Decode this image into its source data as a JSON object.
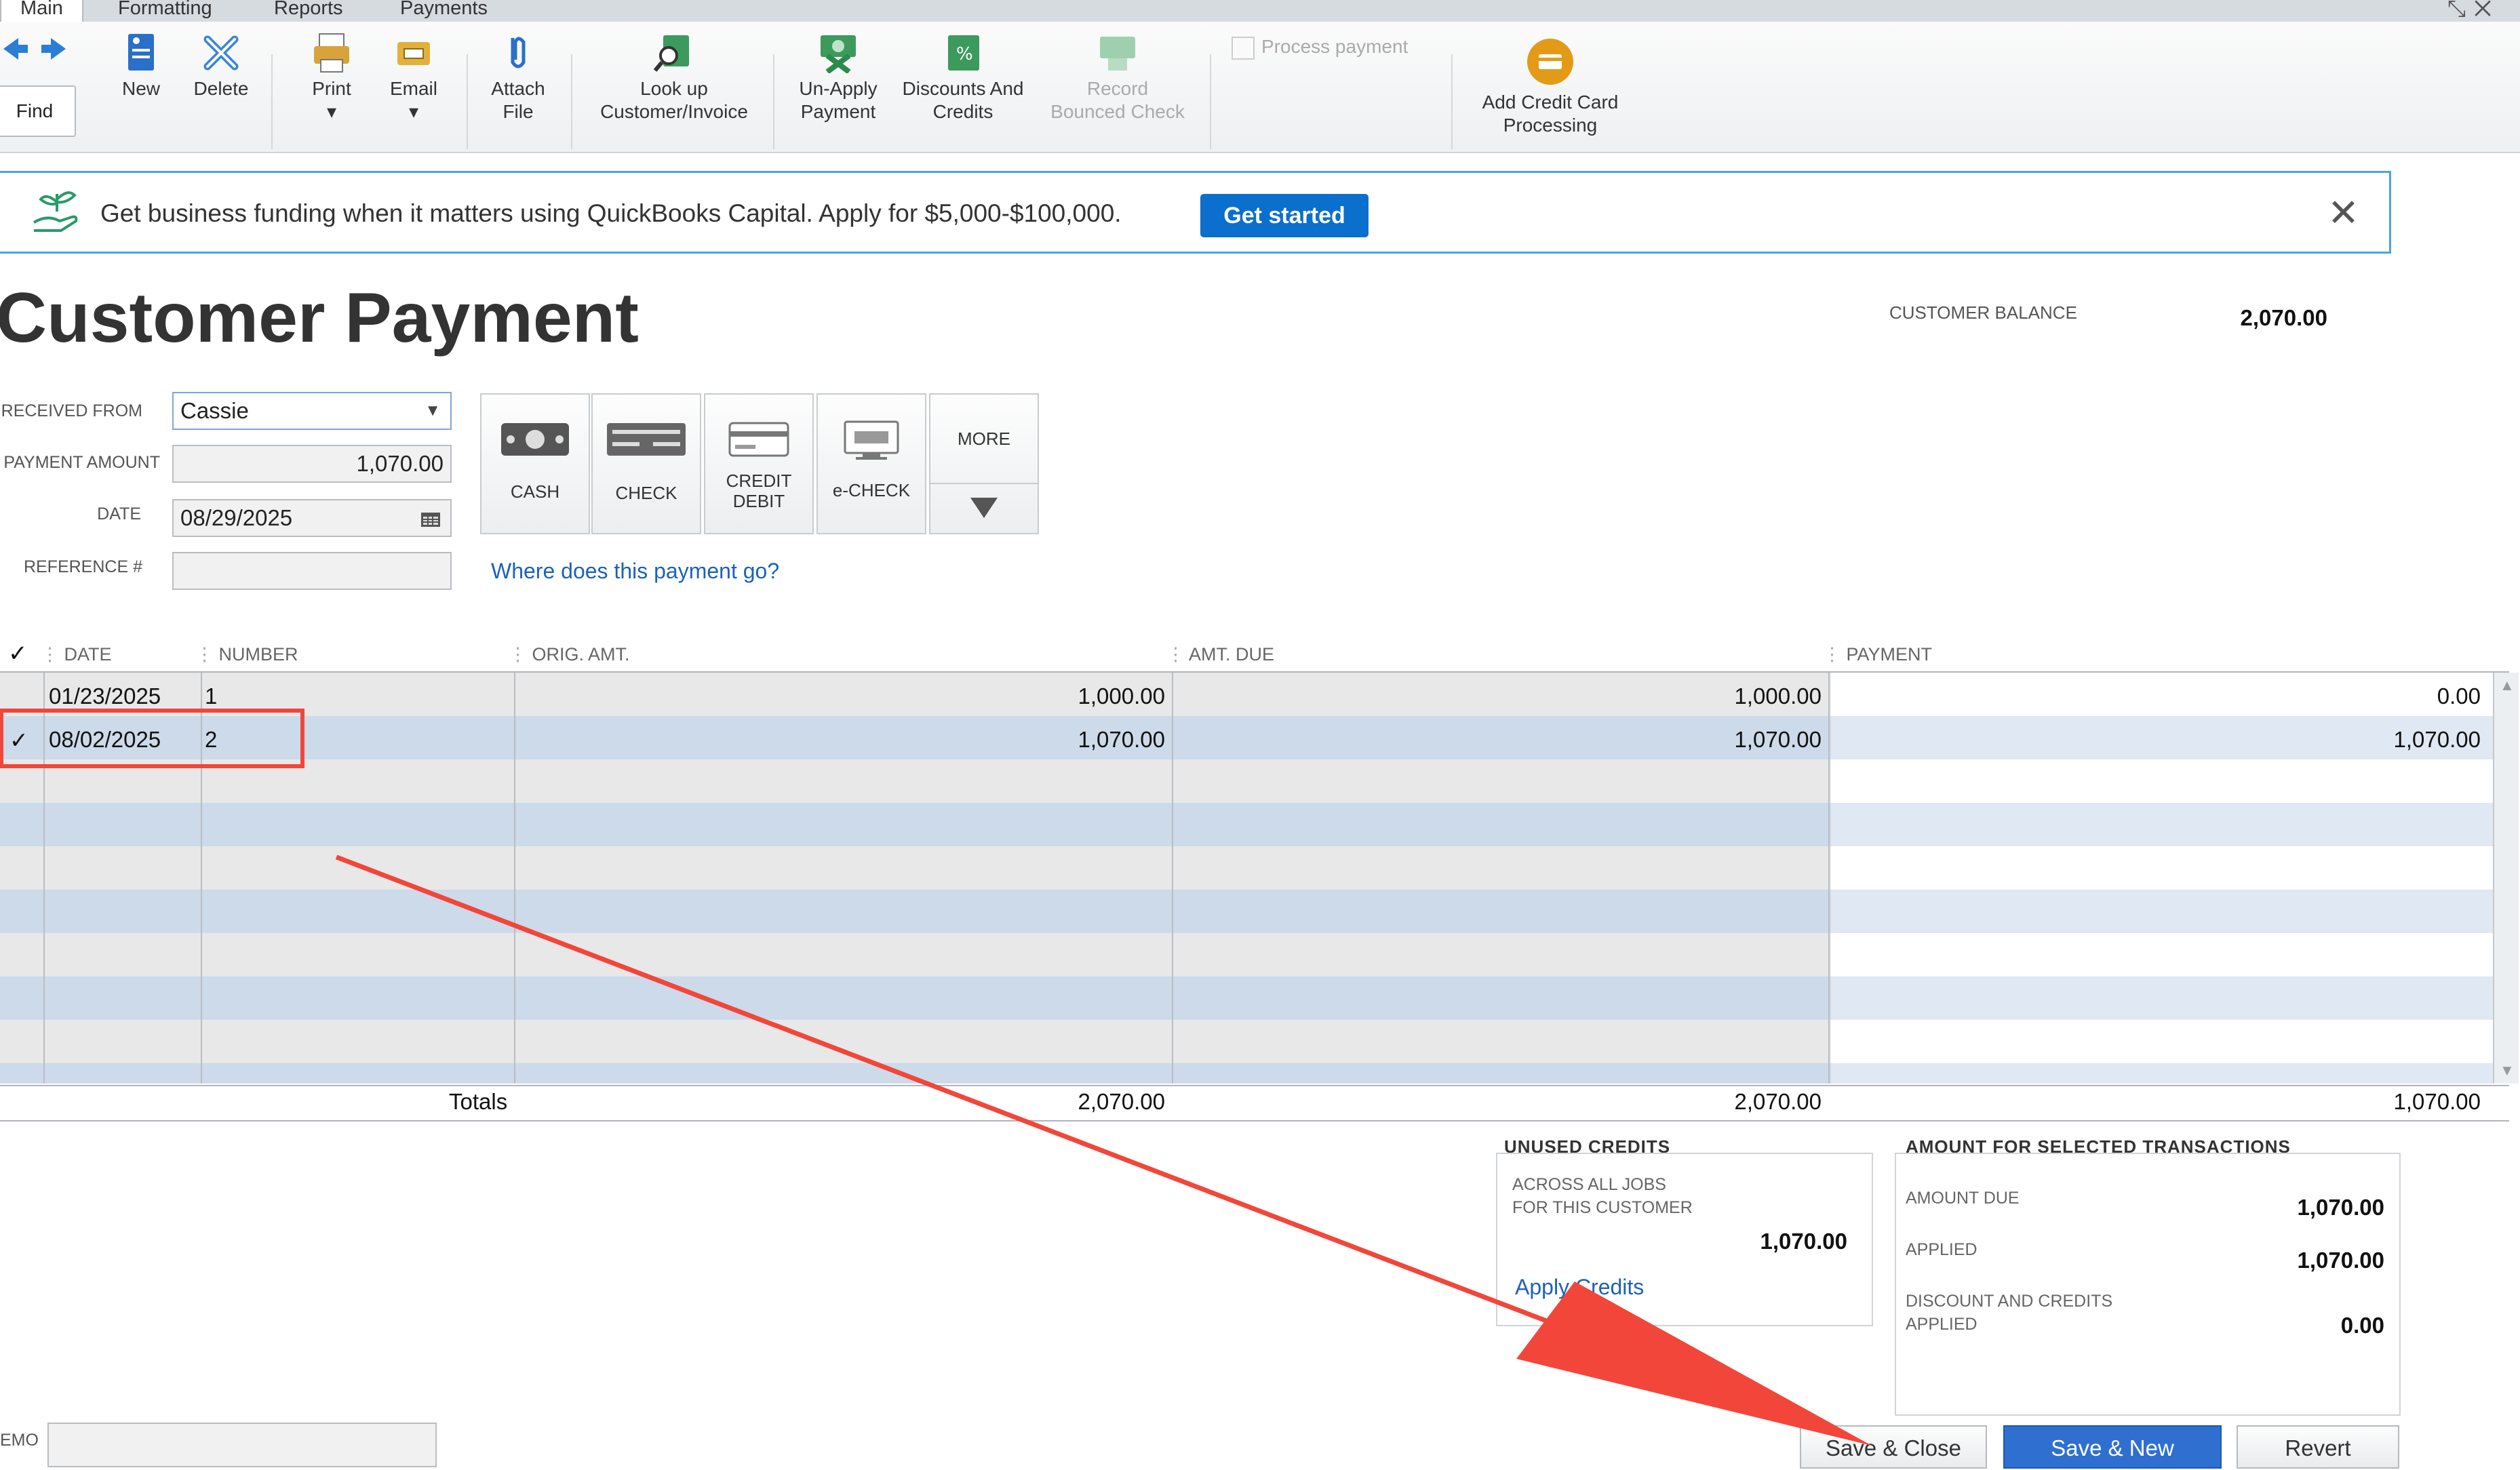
{
  "tabs": [
    {
      "label": "Main"
    },
    {
      "label": "Formatting"
    },
    {
      "label": "Reports"
    },
    {
      "label": "Payments"
    }
  ],
  "toolbar": {
    "find": "Find",
    "new": "New",
    "delete": "Delete",
    "print": "Print",
    "email": "Email",
    "attach_line1": "Attach",
    "attach_line2": "File",
    "lookup_line1": "Look up",
    "lookup_line2": "Customer/Invoice",
    "unapply_line1": "Un-Apply",
    "unapply_line2": "Payment",
    "discounts_line1": "Discounts And",
    "discounts_line2": "Credits",
    "record_line1": "Record",
    "record_line2": "Bounced Check",
    "process_payment": "Process payment",
    "addcc_line1": "Add Credit Card",
    "addcc_line2": "Processing"
  },
  "banner": {
    "text": "Get business funding when it matters using QuickBooks Capital. Apply for $5,000-$100,000.",
    "button": "Get started"
  },
  "form": {
    "title": "Customer Payment",
    "customer_balance_label": "CUSTOMER BALANCE",
    "customer_balance": "2,070.00",
    "received_from_label": "RECEIVED FROM",
    "received_from": "Cassie",
    "payment_amount_label": "PAYMENT AMOUNT",
    "payment_amount": "1,070.00",
    "date_label": "DATE",
    "date": "08/29/2025",
    "reference_label": "REFERENCE #",
    "reference": "",
    "where_link": "Where does this payment go?"
  },
  "methods": {
    "cash": "CASH",
    "check": "CHECK",
    "credit_line1": "CREDIT",
    "credit_line2": "DEBIT",
    "echeck": "e-CHECK",
    "more": "MORE"
  },
  "grid": {
    "headers": {
      "check": "✓",
      "date": "DATE",
      "number": "NUMBER",
      "orig": "ORIG. AMT.",
      "due": "AMT. DUE",
      "payment": "PAYMENT"
    },
    "rows": [
      {
        "check": "",
        "date": "01/23/2025",
        "number": "1",
        "orig": "1,000.00",
        "due": "1,000.00",
        "payment": "0.00"
      },
      {
        "check": "✓",
        "date": "08/02/2025",
        "number": "2",
        "orig": "1,070.00",
        "due": "1,070.00",
        "payment": "1,070.00"
      }
    ],
    "totals": {
      "label": "Totals",
      "orig": "2,070.00",
      "due": "2,070.00",
      "payment": "1,070.00"
    }
  },
  "unused_credits": {
    "title": "UNUSED CREDITS",
    "label_line1": "ACROSS ALL JOBS",
    "label_line2": "FOR THIS CUSTOMER",
    "value": "1,070.00",
    "apply_link": "Apply Credits"
  },
  "selected": {
    "title": "AMOUNT FOR SELECTED TRANSACTIONS",
    "amount_due_label": "AMOUNT DUE",
    "amount_due": "1,070.00",
    "applied_label": "APPLIED",
    "applied": "1,070.00",
    "discount_line1": "DISCOUNT AND CREDITS",
    "discount_line2": "APPLIED",
    "discount": "0.00"
  },
  "memo_label": "EMO",
  "buttons": {
    "save_close": "Save & Close",
    "save_new": "Save & New",
    "revert": "Revert"
  },
  "colors": {
    "accent": "#0b6fcd",
    "annotation": "#f2463a",
    "row_blue": "#ccdaea"
  }
}
